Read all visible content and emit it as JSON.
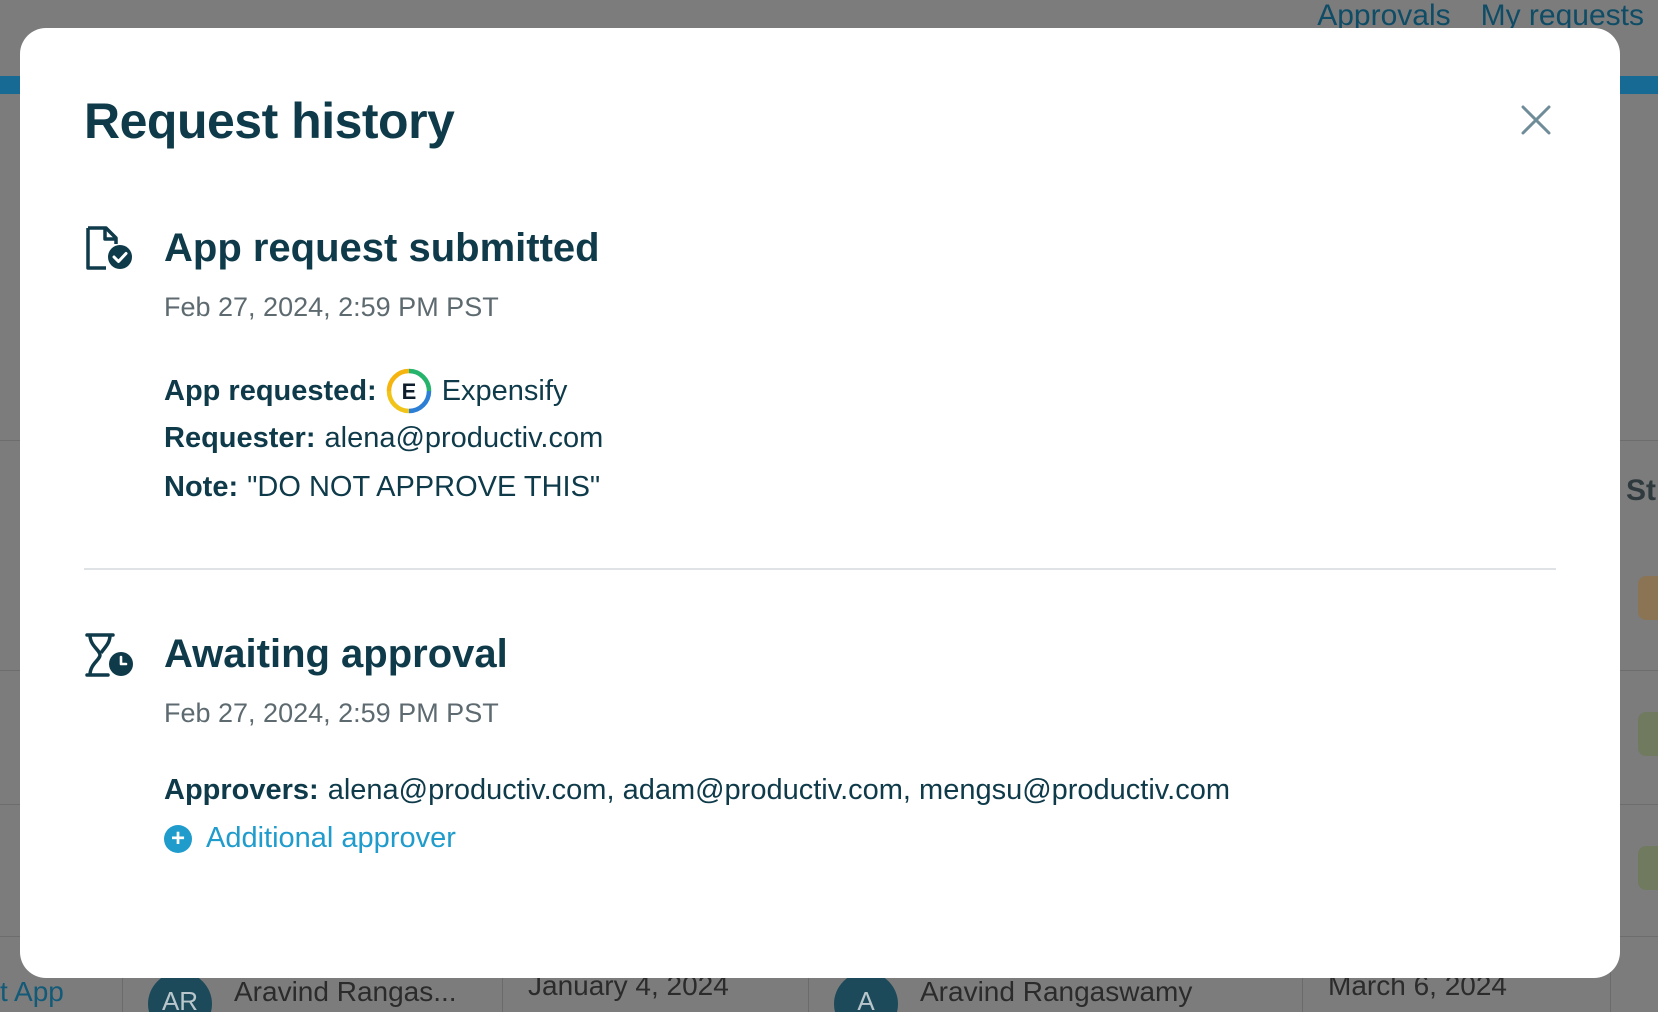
{
  "background": {
    "nav_links": [
      "Approvals",
      "My requests"
    ],
    "bottom_row": {
      "app_link": "t App",
      "requester_initials": "AR",
      "requester_name": "Aravind Rangas...",
      "request_date": "January 4, 2024",
      "approver_initials": "A",
      "approver_name": "Aravind Rangaswamy",
      "approval_date": "March 6, 2024"
    },
    "partial_right_header": "St"
  },
  "modal": {
    "title": "Request history",
    "close_icon": "close-icon",
    "events": [
      {
        "icon": "document-check-icon",
        "title": "App request submitted",
        "timestamp": "Feb 27, 2024, 2:59 PM PST",
        "app_requested_label": "App requested:",
        "app_name": "Expensify",
        "app_logo_letter": "E",
        "requester_label": "Requester:",
        "requester_value": "alena@productiv.com",
        "note_label": "Note:",
        "note_value": "\"DO NOT APPROVE THIS\""
      },
      {
        "icon": "hourglass-clock-icon",
        "title": "Awaiting approval",
        "timestamp": "Feb 27, 2024, 2:59 PM PST",
        "approvers_label": "Approvers:",
        "approvers_value": "alena@productiv.com, adam@productiv.com, mengsu@productiv.com",
        "add_approver_label": "Additional approver"
      }
    ]
  },
  "colors": {
    "title": "#0e3a4a",
    "muted": "#5d6a70",
    "link": "#1f9ccc",
    "divider": "#dfe3e5"
  }
}
